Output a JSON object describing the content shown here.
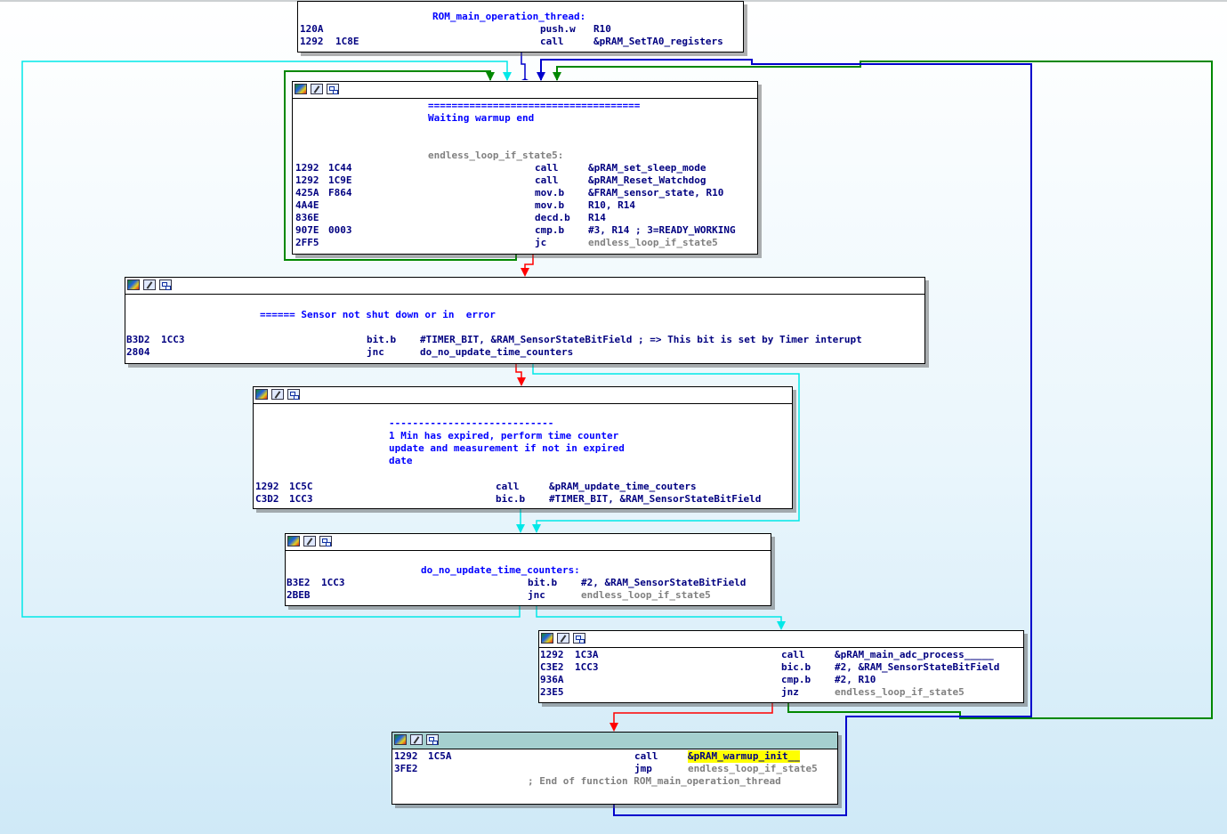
{
  "colors": {
    "edge_true": "#00a000",
    "edge_false": "#ff0000",
    "edge_jump": "#0000cc",
    "edge_loop": "#00e8e8",
    "selected_header": "#a5d0cf",
    "highlight": "#ffff00"
  },
  "icons": [
    "node-colors-icon",
    "rename-node-icon",
    "node-graph-icon"
  ],
  "node0": {
    "label": "ROM_main_operation_thread:",
    "rows": [
      {
        "addr": "120A",
        "bytes": "",
        "mn": "push.w",
        "op": "R10"
      },
      {
        "addr": "1292",
        "bytes": "1C8E",
        "mn": "call",
        "op": "&pRAM_SetTA0_registers"
      }
    ]
  },
  "node1": {
    "sep": "====================================",
    "comment": "Waiting warmup end",
    "label": "endless_loop_if_state5:",
    "rows": [
      {
        "addr": "1292",
        "bytes": "1C44",
        "mn": "call",
        "op": "&pRAM_set_sleep_mode"
      },
      {
        "addr": "1292",
        "bytes": "1C9E",
        "mn": "call",
        "op": "&pRAM_Reset_Watchdog"
      },
      {
        "addr": "425A",
        "bytes": "F864",
        "mn": "mov.b",
        "op": "&FRAM_sensor_state, R10"
      },
      {
        "addr": "4A4E",
        "bytes": "",
        "mn": "mov.b",
        "op": "R10, R14"
      },
      {
        "addr": "836E",
        "bytes": "",
        "mn": "decd.b",
        "op": "R14"
      },
      {
        "addr": "907E",
        "bytes": "0003",
        "mn": "cmp.b",
        "op": "#3, R14 ; 3=READY_WORKING"
      },
      {
        "addr": "2FF5",
        "bytes": "",
        "mn": "jc",
        "op": "endless_loop_if_state5"
      }
    ]
  },
  "node2": {
    "comment": "====== Sensor not shut down or in  error",
    "rows": [
      {
        "addr": "B3D2",
        "bytes": "1CC3",
        "mn": "bit.b",
        "op": "#TIMER_BIT, &RAM_SensorStateBitField ; => This bit is set by Timer interupt"
      },
      {
        "addr": "2804",
        "bytes": "",
        "mn": "jnc",
        "op": "do_no_update_time_counters"
      }
    ]
  },
  "node3": {
    "sep": "----------------------------",
    "comment1": "1 Min has expired, perform time counter",
    "comment2": "update and measurement if not in expired",
    "comment3": "date",
    "rows": [
      {
        "addr": "1292",
        "bytes": "1C5C",
        "mn": "call",
        "op": "&pRAM_update_time_couters"
      },
      {
        "addr": "C3D2",
        "bytes": "1CC3",
        "mn": "bic.b",
        "op": "#TIMER_BIT, &RAM_SensorStateBitField"
      }
    ]
  },
  "node4": {
    "label": "do_no_update_time_counters:",
    "rows": [
      {
        "addr": "B3E2",
        "bytes": "1CC3",
        "mn": "bit.b",
        "op": "#2, &RAM_SensorStateBitField"
      },
      {
        "addr": "2BEB",
        "bytes": "",
        "mn": "jnc",
        "op": "endless_loop_if_state5"
      }
    ]
  },
  "node5": {
    "rows": [
      {
        "addr": "1292",
        "bytes": "1C3A",
        "mn": "call",
        "op": "&pRAM_main_adc_process_____"
      },
      {
        "addr": "C3E2",
        "bytes": "1CC3",
        "mn": "bic.b",
        "op": "#2, &RAM_SensorStateBitField"
      },
      {
        "addr": "936A",
        "bytes": "",
        "mn": "cmp.b",
        "op": "#2, R10"
      },
      {
        "addr": "23E5",
        "bytes": "",
        "mn": "jnz",
        "op": "endless_loop_if_state5"
      }
    ]
  },
  "node6": {
    "rows": [
      {
        "addr": "1292",
        "bytes": "1C5A",
        "mn": "call",
        "op": "&pRAM_warmup_init__"
      },
      {
        "addr": "3FE2",
        "bytes": "",
        "mn": "jmp",
        "op": "endless_loop_if_state5"
      }
    ],
    "end_comment": "; End of function ROM_main_operation_thread"
  }
}
